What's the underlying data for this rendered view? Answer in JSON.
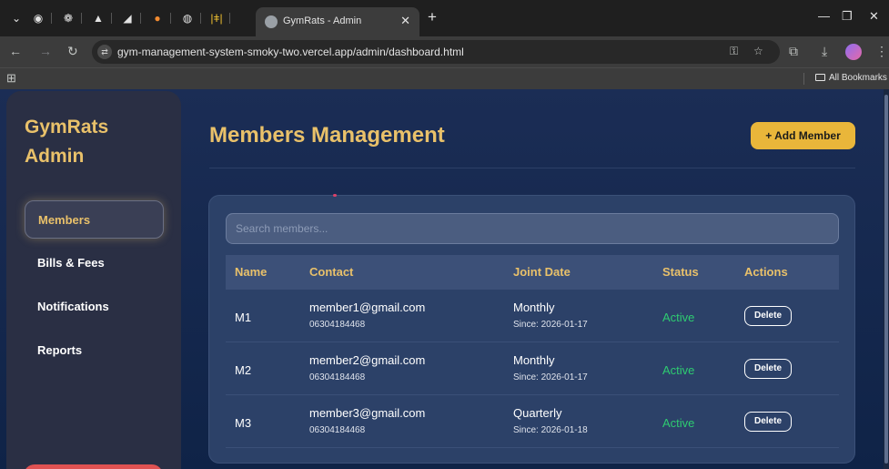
{
  "browser": {
    "tab_title": "GymRats - Admin",
    "url": "gym-management-system-smoky-two.vercel.app/admin/dashboard.html",
    "bookmarks_label": "All Bookmarks"
  },
  "sidebar": {
    "brand": "GymRats Admin",
    "items": [
      {
        "label": "Members",
        "active": true
      },
      {
        "label": "Bills & Fees",
        "active": false
      },
      {
        "label": "Notifications",
        "active": false
      },
      {
        "label": "Reports",
        "active": false
      }
    ]
  },
  "main": {
    "title": "Members Management",
    "add_button": "+ Add Member",
    "search_placeholder": "Search members...",
    "columns": [
      "Name",
      "Contact",
      "Joint Date",
      "Status",
      "Actions"
    ],
    "rows": [
      {
        "name": "M1",
        "email": "member1@gmail.com",
        "phone": "06304184468",
        "plan": "Monthly",
        "since": "Since: 2026-01-17",
        "status": "Active",
        "action": "Delete"
      },
      {
        "name": "M2",
        "email": "member2@gmail.com",
        "phone": "06304184468",
        "plan": "Monthly",
        "since": "Since: 2026-01-17",
        "status": "Active",
        "action": "Delete"
      },
      {
        "name": "M3",
        "email": "member3@gmail.com",
        "phone": "06304184468",
        "plan": "Quarterly",
        "since": "Since: 2026-01-18",
        "status": "Active",
        "action": "Delete"
      }
    ]
  },
  "colors": {
    "accent_gold": "#e9c16a",
    "button_gold": "#e9b63a",
    "status_active": "#2ecc71",
    "page_bg": "#1b2d55",
    "card_bg": "#2c4168"
  }
}
